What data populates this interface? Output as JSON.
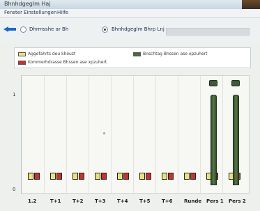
{
  "window": {
    "title": "Bhnhdgeglm Haj"
  },
  "menu": [
    "Fenster",
    "Einstellungen",
    "Hilfe"
  ],
  "toolbar": {
    "radios": [
      {
        "label": "Dhrmsshe ar Bh",
        "selected": false
      },
      {
        "label": "Bhnhdgeglm Bhrp Lnj",
        "selected": true
      }
    ]
  },
  "legend": [
    {
      "label": "Aggefahrts deu kheuzt",
      "color": "#e9e27a"
    },
    {
      "label": "Bnschtag Bhssen ase xpzuhert",
      "color": "#4c6a3a"
    },
    {
      "label": "Kommerhdrasse Bhssen ase xpzuhert",
      "color": "#c7322d"
    }
  ],
  "chart_data": {
    "type": "bar",
    "categories": [
      "1.2",
      "T+1",
      "T+2",
      "T+3",
      "T+4",
      "T+5",
      "T+6",
      "Runde",
      "Pers 1",
      "Pers 2"
    ],
    "ylim": [
      0,
      1
    ],
    "yticks": [
      "1",
      "0"
    ],
    "series": [
      {
        "name": "Bnschtag Bhssen ase xpzuhert",
        "values": [
          0,
          0,
          0,
          0,
          0,
          0,
          0,
          0,
          1,
          1
        ]
      }
    ],
    "grid": true,
    "legend_position": "top"
  }
}
